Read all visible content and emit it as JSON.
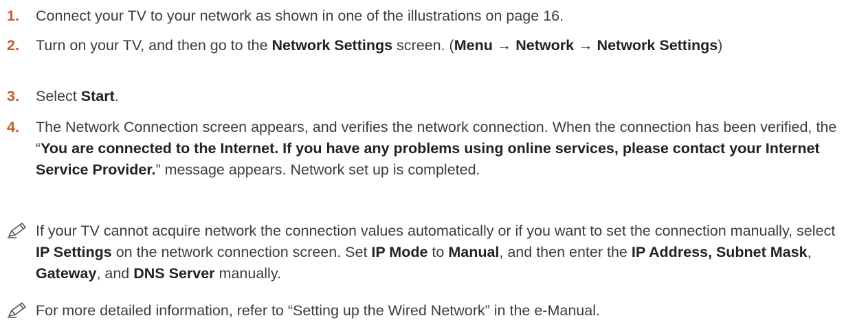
{
  "accent_color": "#c85a1e",
  "steps": [
    {
      "number": "1.",
      "parts": [
        {
          "t": "Connect your TV to your network as shown in one of the illustrations on page 16.",
          "b": false
        }
      ]
    },
    {
      "number": "2.",
      "parts": [
        {
          "t": "Turn on your TV, and then go to the ",
          "b": false
        },
        {
          "t": "Network Settings",
          "b": true
        },
        {
          "t": " screen. (",
          "b": false
        },
        {
          "t": "Menu → Network → Network Settings",
          "b": true
        },
        {
          "t": ")",
          "b": false
        }
      ]
    },
    {
      "number": "3.",
      "parts": [
        {
          "t": "Select ",
          "b": false
        },
        {
          "t": "Start",
          "b": true
        },
        {
          "t": ".",
          "b": false
        }
      ]
    },
    {
      "number": "4.",
      "parts": [
        {
          "t": "The Network Connection screen appears, and verifies the network connection. When the connection has been verified, the “",
          "b": false
        },
        {
          "t": "You are connected to the Internet. If you have any problems using online services, please contact your Internet Service Provider.",
          "b": true
        },
        {
          "t": "” message appears. Network set up is completed.",
          "b": false
        }
      ]
    }
  ],
  "notes": [
    {
      "icon": "pencil-note-icon",
      "parts": [
        {
          "t": "If your TV cannot acquire network the connection values automatically or if you want to set the connection manually, select ",
          "b": false
        },
        {
          "t": "IP Settings",
          "b": true
        },
        {
          "t": " on the network connection screen. Set ",
          "b": false
        },
        {
          "t": "IP Mode",
          "b": true
        },
        {
          "t": " to ",
          "b": false
        },
        {
          "t": "Manual",
          "b": true
        },
        {
          "t": ", and then enter the ",
          "b": false
        },
        {
          "t": "IP Address, Subnet Mask",
          "b": true
        },
        {
          "t": ", ",
          "b": false
        },
        {
          "t": "Gateway",
          "b": true
        },
        {
          "t": ", and ",
          "b": false
        },
        {
          "t": "DNS Server",
          "b": true
        },
        {
          "t": " manually.",
          "b": false
        }
      ]
    },
    {
      "icon": "pencil-note-icon",
      "parts": [
        {
          "t": "For more detailed information, refer to “Setting up the Wired Network” in the e-Manual.",
          "b": false
        }
      ]
    }
  ]
}
